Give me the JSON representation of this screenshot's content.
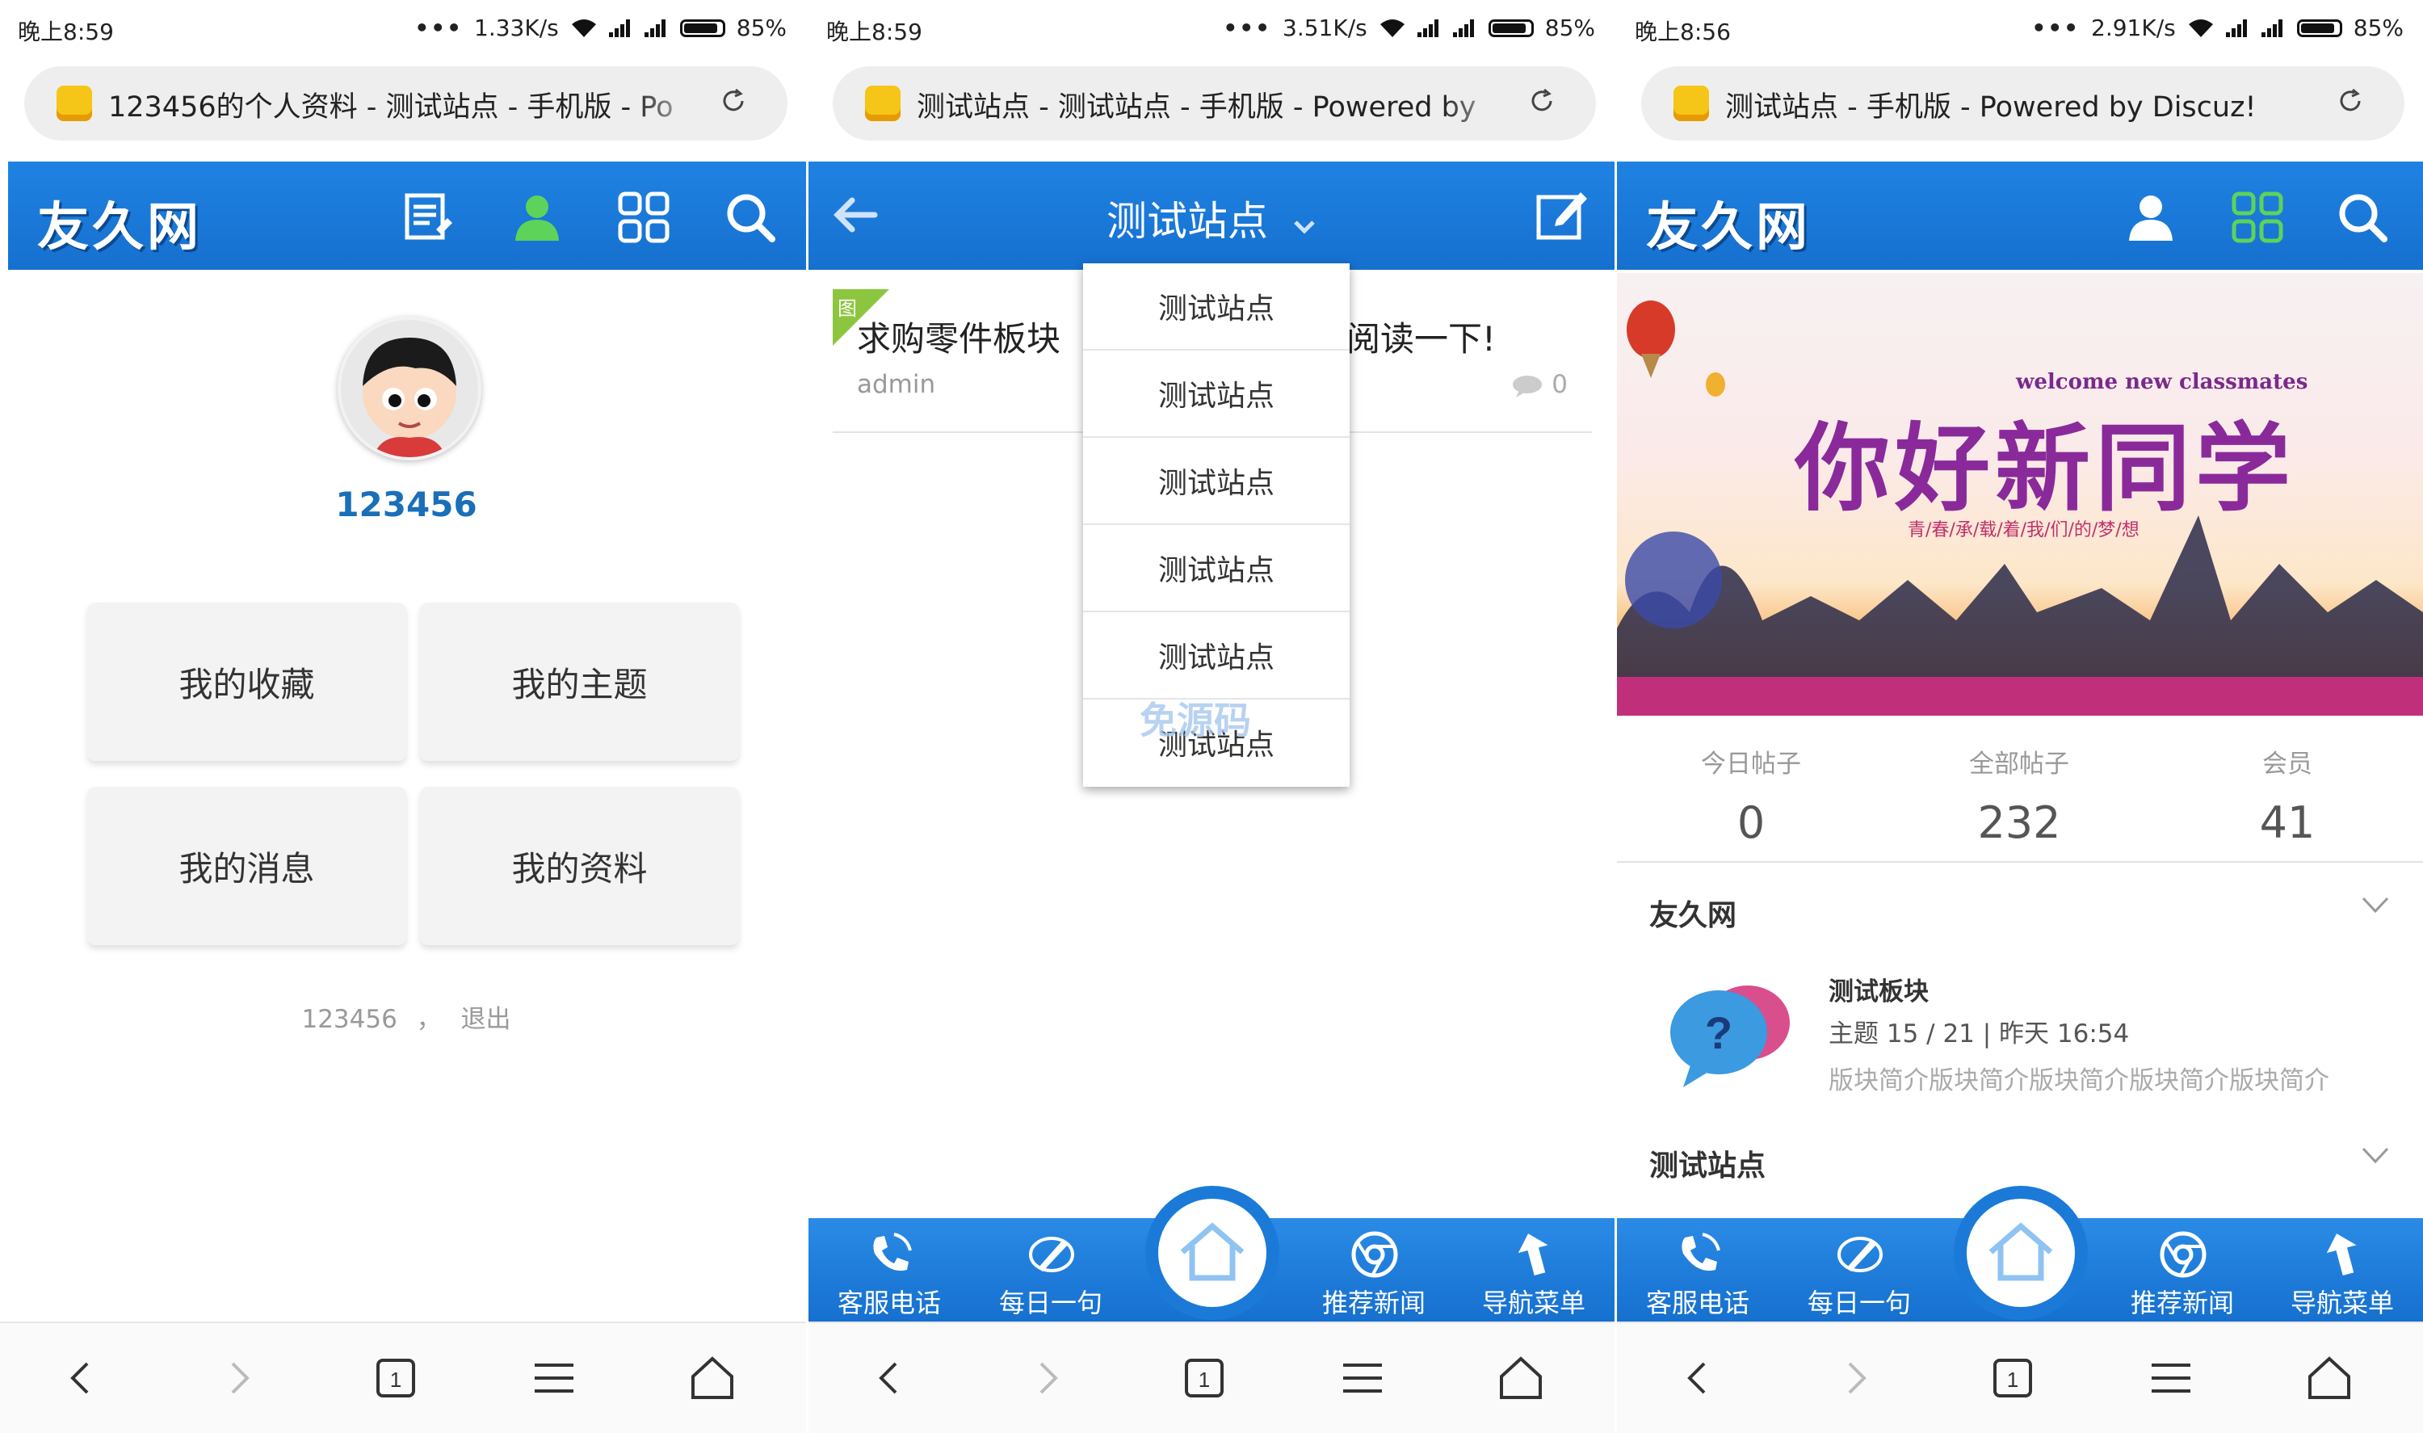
{
  "colors": {
    "brand_blue": "#1a76d6",
    "logo_text": "#ffffff",
    "link_blue": "#1a6fb8",
    "green_tag": "#8cc63f"
  },
  "phone1": {
    "status": {
      "time": "晚上8:59",
      "dots": "•••",
      "speed": "1.33K/s",
      "battery": "85%"
    },
    "url": "123456的个人资料 - 测试站点 - 手机版 - Po",
    "nav": {
      "logo": "友久网",
      "icons": [
        "thread-list-icon",
        "user-icon",
        "grid-icon",
        "search-icon"
      ]
    },
    "profile": {
      "username": "123456"
    },
    "tiles": [
      "我的收藏",
      "我的主题",
      "我的消息",
      "我的资料"
    ],
    "footer": {
      "user": "123456",
      "sep": "，",
      "logout": "退出"
    }
  },
  "phone2": {
    "status": {
      "time": "晚上8:59",
      "dots": "•••",
      "speed": "3.51K/s",
      "battery": "85%"
    },
    "url": "测试站点 - 测试站点 - 手机版 - Powered by",
    "nav": {
      "title": "测试站点"
    },
    "thread": {
      "tag": "图",
      "title": "求购零件板块",
      "title_tail": "阅读一下!",
      "author": "admin",
      "replies": "0"
    },
    "dropdown": [
      "测试站点",
      "测试站点",
      "测试站点",
      "测试站点",
      "测试站点",
      "测试站点"
    ],
    "watermark": "免源码"
  },
  "phone3": {
    "status": {
      "time": "晚上8:56",
      "dots": "•••",
      "speed": "2.91K/s",
      "battery": "85%"
    },
    "url": "测试站点 - 手机版 - Powered by Discuz!",
    "nav": {
      "logo": "友久网"
    },
    "banner": {
      "welcome": "welcome new classmates",
      "title": "你好新同学",
      "sub": "青/春/承/载/着/我/们/的/梦/想"
    },
    "stats": [
      {
        "label": "今日帖子",
        "value": "0"
      },
      {
        "label": "全部帖子",
        "value": "232"
      },
      {
        "label": "会员",
        "value": "41"
      }
    ],
    "section1": {
      "title": "友久网"
    },
    "forum": {
      "name": "测试板块",
      "meta": "主题 15 / 21 | 昨天 16:54",
      "desc": "版块简介版块简介版块简介版块简介版块简介"
    },
    "section2": {
      "title": "测试站点"
    }
  },
  "bottom_bar": {
    "items": [
      "客服电话",
      "每日一句",
      "推荐新闻",
      "导航菜单"
    ],
    "icons": [
      "phone-icon",
      "pen-icon",
      "home-icon",
      "chrome-icon",
      "back-arrow-icon"
    ]
  },
  "browser_chrome": {
    "tab_count": "1",
    "icons": [
      "back-icon",
      "forward-icon",
      "tabs-icon",
      "menu-icon",
      "home-icon"
    ]
  }
}
